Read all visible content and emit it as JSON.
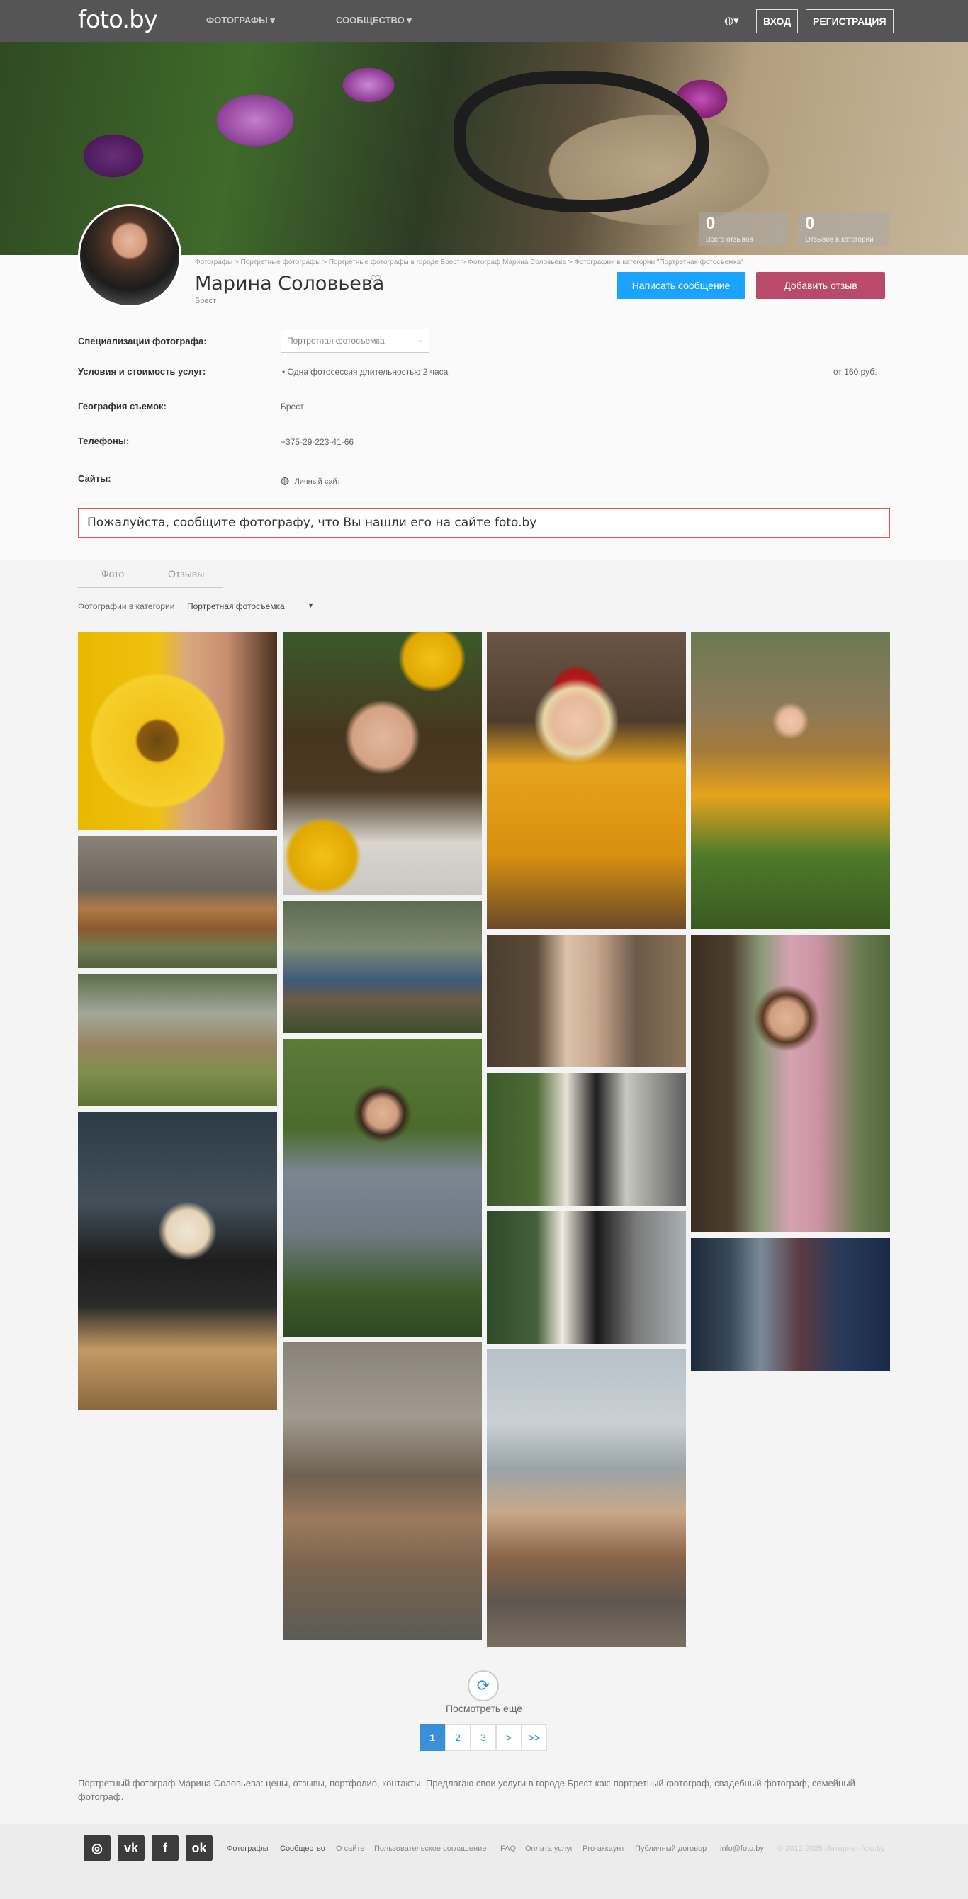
{
  "header": {
    "logo": "foto.by",
    "nav": [
      "ФОТОГРАФЫ ▾",
      "СООБЩЕСТВО ▾"
    ],
    "globe_icon": "globe-icon",
    "login": "ВХОД",
    "register": "РЕГИСТРАЦИЯ"
  },
  "stats": [
    {
      "num": "0",
      "label": "Всего отзывов"
    },
    {
      "num": "0",
      "label": "Отзывов в категории"
    }
  ],
  "breadcrumbs": "Фотографы > Портретные фотографы > Портретные фотографы в городе Брест > Фотограф Марина Соловьева > Фотографии в категории \"Портретная фотосъемка\"",
  "profile": {
    "name": "Марина Соловьева",
    "heart": "♡",
    "city": "Брест",
    "message_button": "Написать сообщение",
    "review_button": "Добавить отзыв"
  },
  "details": {
    "spec_label": "Специализации фотографа:",
    "spec_value": "Портретная фотосъемка",
    "spec_caret": "⌄",
    "terms_label": "Условия и стоимость услуг:",
    "terms_item": "•  Одна фотосессия длительностью 2 часа",
    "terms_price": "от 160 руб.",
    "geo_label": "География съемок:",
    "geo_value": "Брест",
    "phone_label": "Телефоны:",
    "phone_value": "+375-29-223-41-66",
    "sites_label": "Сайты:",
    "site_value": "Личный сайт"
  },
  "notice": "Пожалуйста, сообщите фотографу, что Вы нашли его на сайте foto.by",
  "tabs": [
    "Фото",
    "Отзывы"
  ],
  "category": {
    "label": "Фотографии в категории",
    "value": "Портретная фотосъемка",
    "caret": "▾"
  },
  "more": {
    "icon": "refresh-icon",
    "label": "Посмотреть еще"
  },
  "pagination": [
    "1",
    "2",
    "3",
    ">",
    ">>"
  ],
  "seo_text": "Портретный фотограф Марина Соловьева: цены, отзывы, портфолио, контакты. Предлагаю свои услуги в городе Брест как: портретный фотограф, свадебный фотограф, семейный фотограф.",
  "footer": {
    "social": [
      {
        "icon": "instagram-icon",
        "glyph": "◎"
      },
      {
        "icon": "vk-icon",
        "glyph": "vk"
      },
      {
        "icon": "facebook-icon",
        "glyph": "f"
      },
      {
        "icon": "odnoklassniki-icon",
        "glyph": "ok"
      }
    ],
    "links": [
      "Фотографы",
      "Сообщество",
      "О сайте",
      "Пользовательское соглашение",
      "FAQ",
      "Оплата услуг",
      "Pro-аккаунт",
      "Публичный договор",
      "info@foto.by"
    ],
    "copyright": "© 2012-2025 Интернет-foto.by"
  }
}
